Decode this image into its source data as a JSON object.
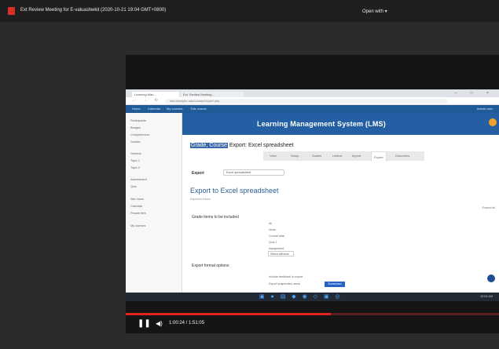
{
  "window": {
    "file_title": "Ext Review Meeting for E-valuashwkit (2020-10-21 19:04 GMT+0800)",
    "open_with": "Open with ▾"
  },
  "browser": {
    "tab1": "Learning Man...",
    "tab2": "Ext. Review Meeting...",
    "controls": "− □ ×",
    "nav": "← → ↻",
    "address": "lms.example.edu/course/export.php"
  },
  "lms": {
    "nav_items": [
      "Home",
      "Calendar",
      "My courses",
      "This course"
    ],
    "user": "Admin user",
    "header_title": "Learning Management System (LMS)",
    "sidebar": [
      "Participants",
      "Badges",
      "Competencies",
      "Grades",
      "General",
      "Topic 1",
      "Topic 2",
      "Assessment",
      "Quiz",
      "Site home",
      "Calendar",
      "Private files",
      "My courses"
    ],
    "breadcrumb_prefix": "Grade, Course",
    "breadcrumb_rest": "Export: Excel spreadsheet",
    "tabs": [
      "View",
      "Setup",
      "Scales",
      "Letters",
      "Import",
      "Export",
      "Outcomes"
    ],
    "export_label": "Export",
    "export_select": "Excel spreadsheet",
    "page_heading": "Export to Excel spreadsheet",
    "subnote": "Export to Excel",
    "right_note": "Expand all",
    "section_items": "Grade items to be included",
    "section_options": "Export format options",
    "options": [
      "All",
      "None",
      "Course total",
      "Quiz 1",
      "Assignment"
    ],
    "select_all_button": "Select all/none",
    "option_lines": [
      "Include feedback in export",
      "Export suspended users"
    ],
    "download_button": "Download"
  },
  "taskbar": {
    "time": "10:04 AM"
  },
  "video": {
    "timer": "1:00:24 / 1:51:05",
    "play_icon": "pause-icon",
    "volume_icon": "volume-icon",
    "progress_fraction": 0.55
  }
}
